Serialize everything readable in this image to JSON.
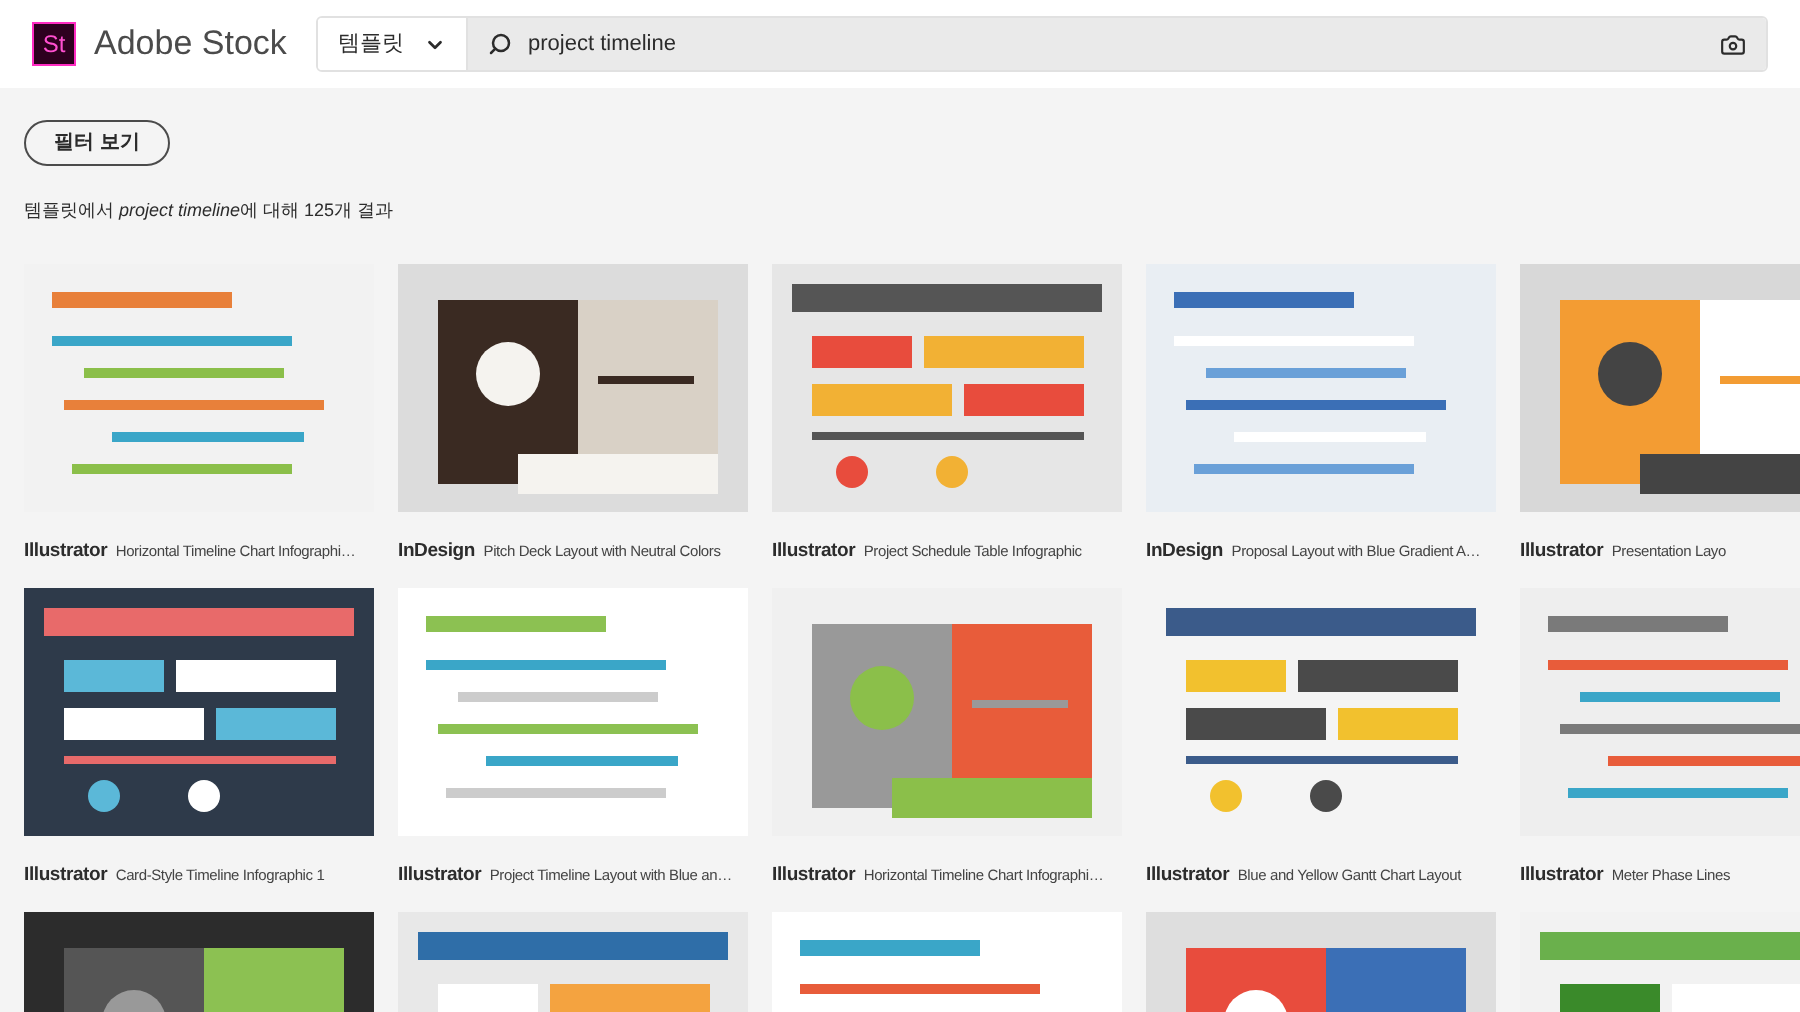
{
  "header": {
    "logo": {
      "mark": "St",
      "name": "Adobe Stock"
    },
    "search": {
      "category": "템플릿",
      "value": "project timeline"
    }
  },
  "filter_button": "필터 보기",
  "result_summary": {
    "before": "템플릿에서",
    "query": "project timeline",
    "after": "에 대해 125개 결과"
  },
  "results": [
    {
      "kind": "item",
      "app": "Illustrator",
      "title": "Horizontal Timeline Chart Infographi…"
    },
    {
      "kind": "item",
      "app": "InDesign",
      "title": "Pitch Deck Layout with Neutral Colors"
    },
    {
      "kind": "item",
      "app": "Illustrator",
      "title": "Project Schedule Table Infographic"
    },
    {
      "kind": "item",
      "app": "InDesign",
      "title": "Proposal Layout with Blue Gradient A…"
    },
    {
      "kind": "item",
      "app": "Illustrator",
      "title": "Presentation Layo"
    },
    {
      "kind": "item",
      "app": "Illustrator",
      "title": "Card-Style Timeline Infographic 1"
    },
    {
      "kind": "item",
      "app": "Illustrator",
      "title": "Project Timeline Layout with Blue an…"
    },
    {
      "kind": "item",
      "app": "Illustrator",
      "title": "Horizontal Timeline Chart Infographi…"
    },
    {
      "kind": "item",
      "app": "Illustrator",
      "title": "Blue and Yellow Gantt Chart Layout"
    },
    {
      "kind": "item",
      "app": "Illustrator",
      "title": "Meter Phase Lines"
    },
    {
      "kind": "picture"
    },
    {
      "kind": "picture"
    },
    {
      "kind": "picture"
    },
    {
      "kind": "picture"
    },
    {
      "kind": "picture"
    }
  ]
}
